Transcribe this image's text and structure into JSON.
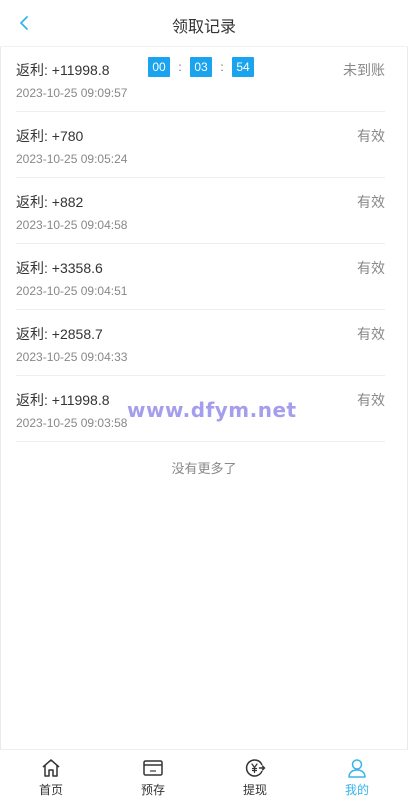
{
  "header": {
    "title": "领取记录"
  },
  "countdown": {
    "hours": "00",
    "minutes": "03",
    "seconds": "54",
    "sep": ":"
  },
  "records": [
    {
      "amount": "返利: +11998.8",
      "time": "2023-10-25 09:09:57",
      "status": "未到账"
    },
    {
      "amount": "返利: +780",
      "time": "2023-10-25 09:05:24",
      "status": "有效"
    },
    {
      "amount": "返利: +882",
      "time": "2023-10-25 09:04:58",
      "status": "有效"
    },
    {
      "amount": "返利: +3358.6",
      "time": "2023-10-25 09:04:51",
      "status": "有效"
    },
    {
      "amount": "返利: +2858.7",
      "time": "2023-10-25 09:04:33",
      "status": "有效"
    },
    {
      "amount": "返利: +11998.8",
      "time": "2023-10-25 09:03:58",
      "status": "有效"
    }
  ],
  "footer_text": "没有更多了",
  "watermark": "www.dfym.net",
  "tabbar": [
    {
      "label": "首页",
      "icon": "home-icon"
    },
    {
      "label": "预存",
      "icon": "wallet-icon"
    },
    {
      "label": "提现",
      "icon": "withdraw-icon"
    },
    {
      "label": "我的",
      "icon": "user-icon"
    }
  ],
  "colors": {
    "accent": "#36b5ec",
    "countdown_bg": "#1aa3ee",
    "watermark": "#8f86e8"
  }
}
